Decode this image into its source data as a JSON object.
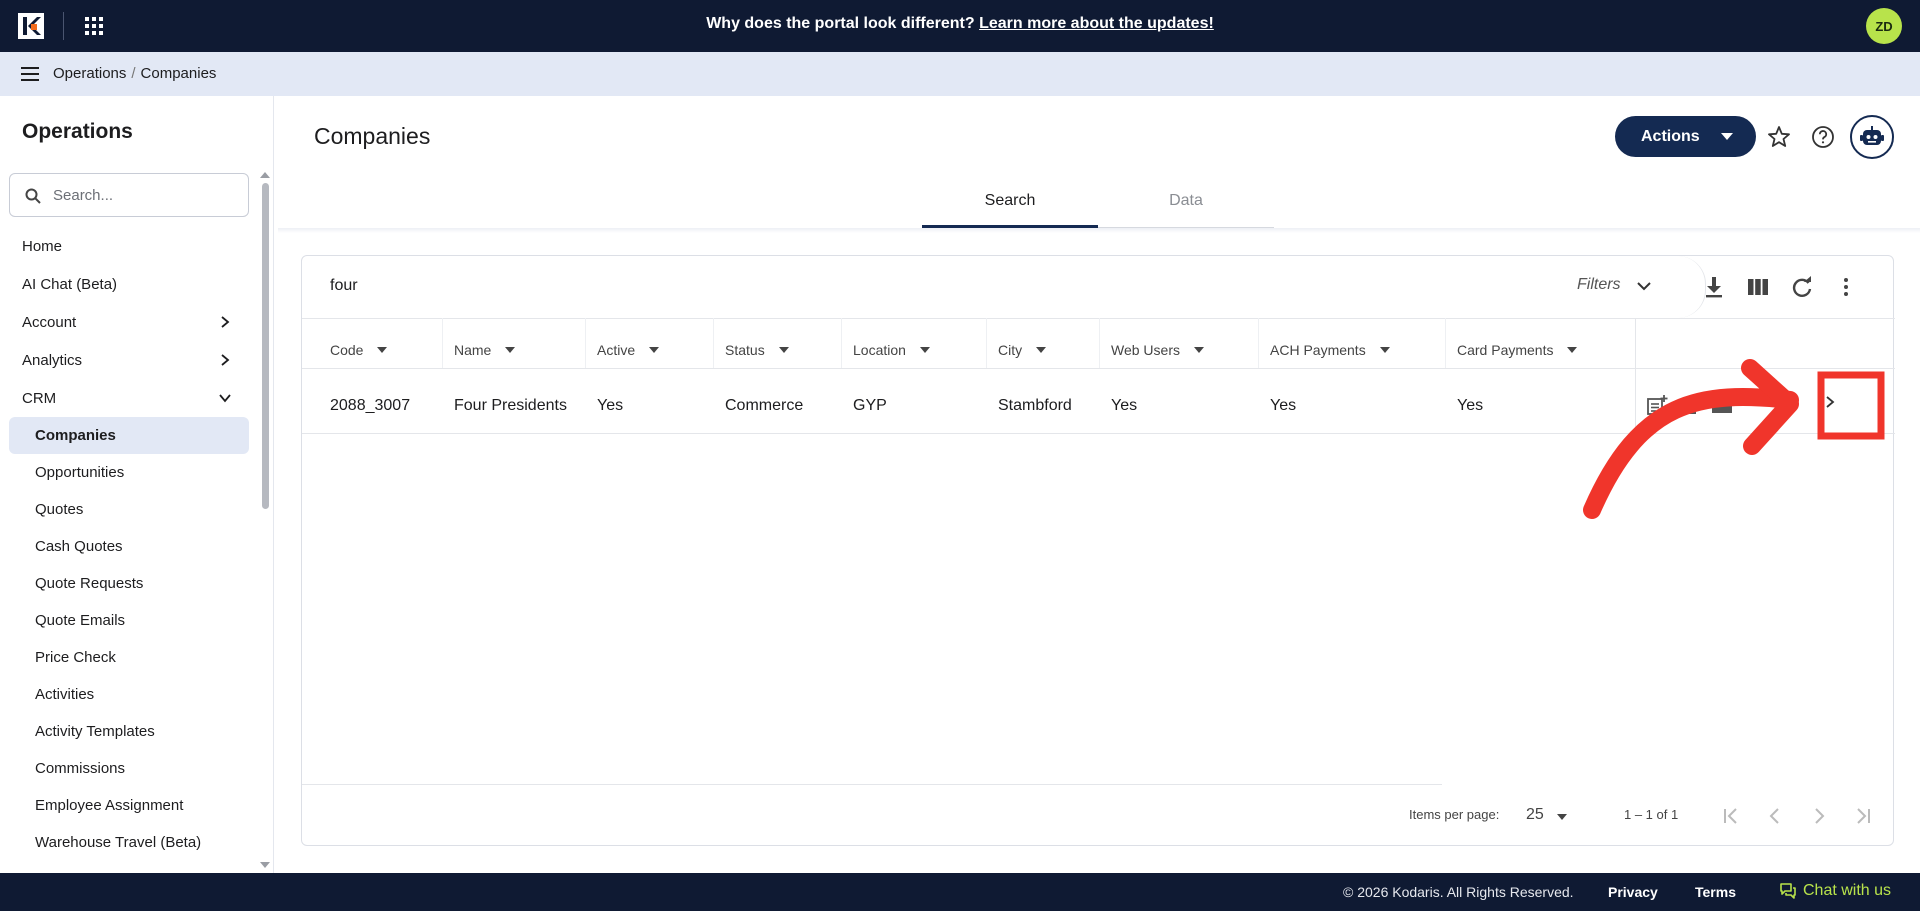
{
  "banner": {
    "question": "Why does the portal look different?",
    "link": "Learn more about the updates!"
  },
  "user": {
    "initials": "ZD"
  },
  "breadcrumb": {
    "section": "Operations",
    "separator": "/",
    "page": "Companies"
  },
  "sidebar": {
    "title": "Operations",
    "search_placeholder": "Search...",
    "items": [
      {
        "label": "Home"
      },
      {
        "label": "AI Chat (Beta)"
      },
      {
        "label": "Account"
      },
      {
        "label": "Analytics"
      },
      {
        "label": "CRM"
      },
      {
        "label": "Companies"
      },
      {
        "label": "Opportunities"
      },
      {
        "label": "Quotes"
      },
      {
        "label": "Cash Quotes"
      },
      {
        "label": "Quote Requests"
      },
      {
        "label": "Quote Emails"
      },
      {
        "label": "Price Check"
      },
      {
        "label": "Activities"
      },
      {
        "label": "Activity Templates"
      },
      {
        "label": "Commissions"
      },
      {
        "label": "Employee Assignment"
      },
      {
        "label": "Warehouse Travel (Beta)"
      }
    ]
  },
  "main": {
    "title": "Companies",
    "actions_label": "Actions",
    "tabs": [
      {
        "label": "Search"
      },
      {
        "label": "Data"
      }
    ]
  },
  "grid": {
    "search_value": "four",
    "filters_label": "Filters",
    "columns": [
      "Code",
      "Name",
      "Active",
      "Status",
      "Location",
      "City",
      "Web Users",
      "ACH Payments",
      "Card Payments"
    ],
    "rows": [
      [
        "2088_3007",
        "Four Presidents",
        "Yes",
        "Commerce",
        "GYP",
        "Stambford",
        "Yes",
        "Yes",
        "Yes"
      ]
    ],
    "paginator": {
      "items_per_page_label": "Items per page:",
      "items_per_page": "25",
      "range": "1 – 1 of 1"
    }
  },
  "footer": {
    "copyright": "© 2026 Kodaris. All Rights Reserved.",
    "privacy": "Privacy",
    "terms": "Terms",
    "chat": "Chat with us"
  },
  "colors": {
    "navy": "#0f1a33",
    "primary": "#142a52",
    "accent_green": "#b8e34b",
    "annotation_red": "#f0352b",
    "active_bg": "#e2e8f5"
  }
}
